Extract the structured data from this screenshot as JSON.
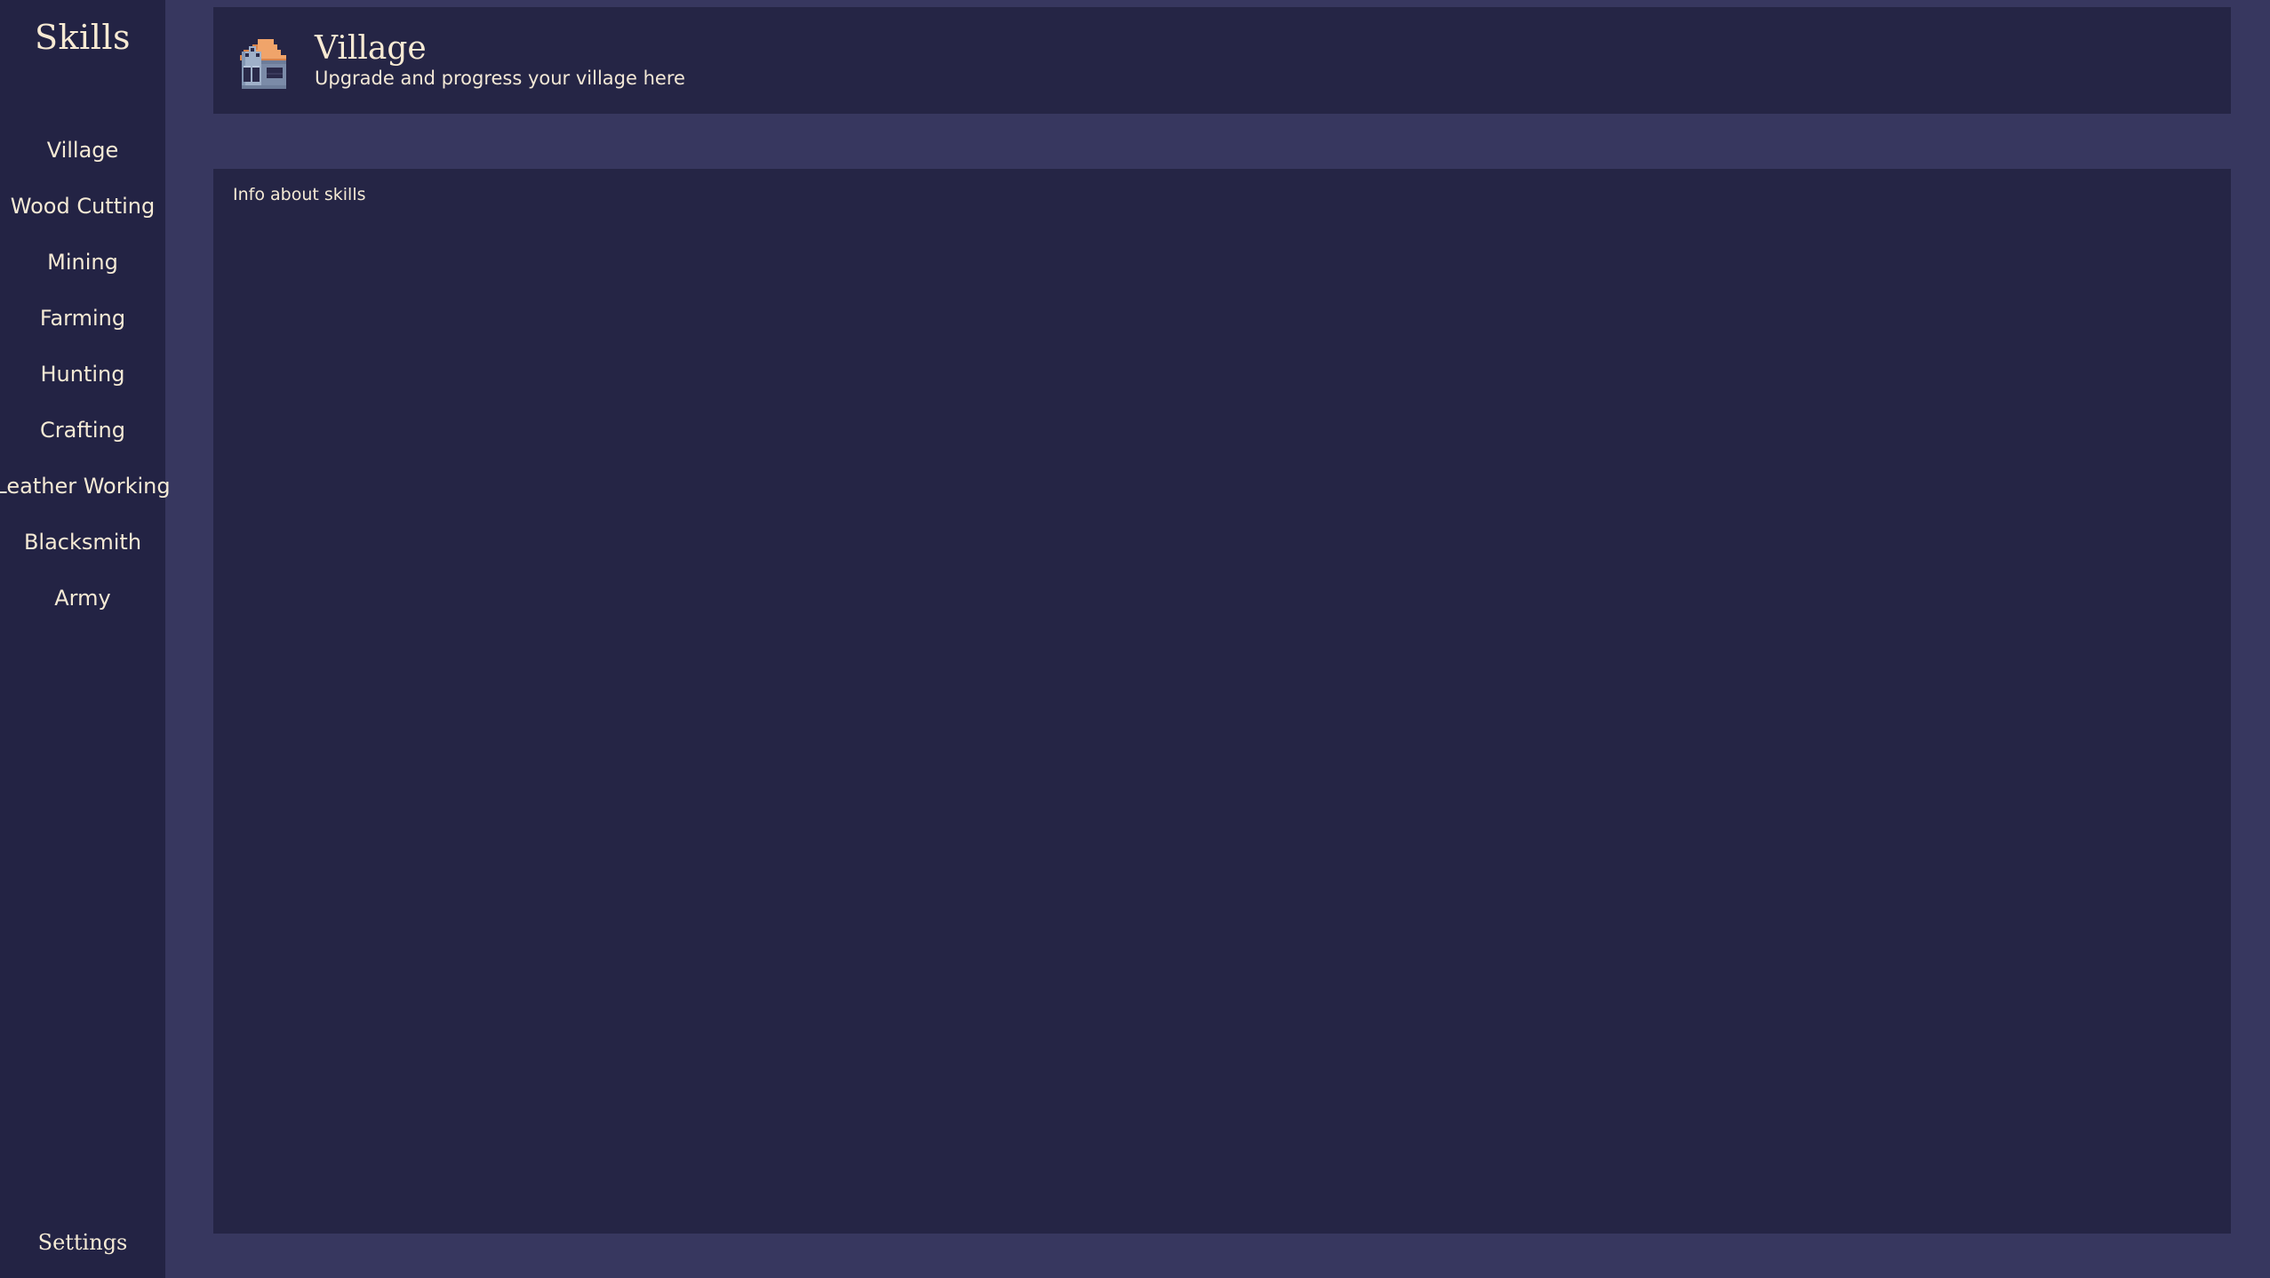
{
  "colors": {
    "sidebar_bg": "#232344",
    "page_bg": "#37375f",
    "panel_bg": "#252545",
    "text_cream": "#f5ead5",
    "title_cream": "#f7ead3",
    "roof_orange": "#f0a46a",
    "roof_orange_dark": "#d9834a",
    "wall_blue": "#9fb0c9",
    "wall_blue_dark": "#7b8ba8",
    "window_dark": "#2a2a4a"
  },
  "sidebar": {
    "title": "Skills",
    "items": [
      {
        "label": "Village",
        "name": "sidebar-item-village"
      },
      {
        "label": "Wood Cutting",
        "name": "sidebar-item-wood-cutting"
      },
      {
        "label": "Mining",
        "name": "sidebar-item-mining"
      },
      {
        "label": "Farming",
        "name": "sidebar-item-farming"
      },
      {
        "label": "Hunting",
        "name": "sidebar-item-hunting"
      },
      {
        "label": "Crafting",
        "name": "sidebar-item-crafting"
      },
      {
        "label": "Leather Working",
        "name": "sidebar-item-leather-working"
      },
      {
        "label": "Blacksmith",
        "name": "sidebar-item-blacksmith"
      },
      {
        "label": "Army",
        "name": "sidebar-item-army"
      }
    ],
    "settings_label": "Settings"
  },
  "header": {
    "icon": "village-house-icon",
    "title": "Village",
    "subtitle": "Upgrade and progress your village here"
  },
  "content": {
    "info_text": "Info about skills"
  }
}
